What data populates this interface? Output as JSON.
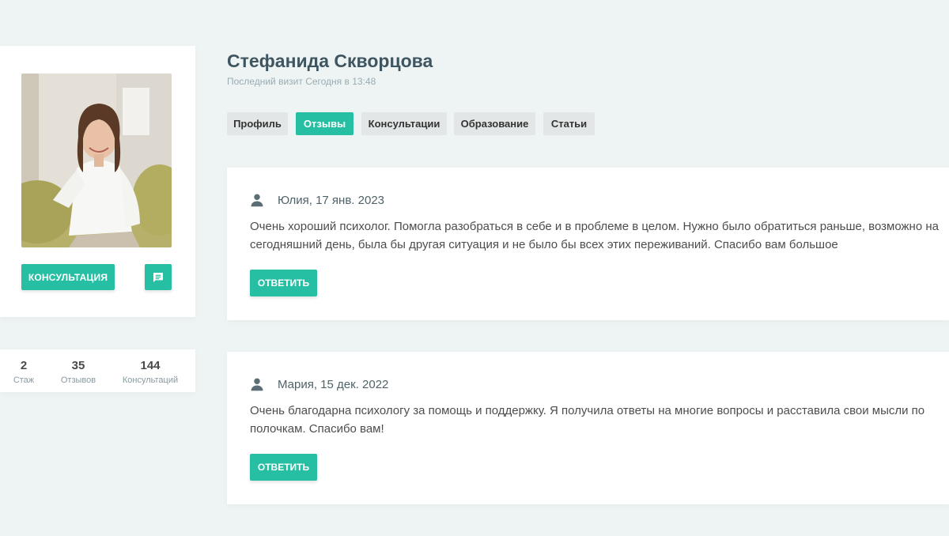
{
  "profile": {
    "name": "Стефанида Скворцова",
    "last_visit": "Последний визит Сегодня в 13:48",
    "consult_button": "КОНСУЛЬТАЦИЯ",
    "chat_icon": "chat-bubble-icon"
  },
  "stats": [
    {
      "value": "2",
      "label": "Стаж"
    },
    {
      "value": "35",
      "label": "Отзывов"
    },
    {
      "value": "144",
      "label": "Консультаций"
    }
  ],
  "tabs": [
    {
      "label": "Профиль",
      "active": false
    },
    {
      "label": "Отзывы",
      "active": true
    },
    {
      "label": "Консультации",
      "active": false
    },
    {
      "label": "Образование",
      "active": false
    },
    {
      "label": "Статьи",
      "active": false
    }
  ],
  "reviews": [
    {
      "author": "Юлия, 17 янв. 2023",
      "text": "Очень хороший психолог. Помогла разобраться в себе и в проблеме в целом. Нужно было обратиться раньше, возможно на сегодняшний день, была бы другая ситуация и не было бы всех этих переживаний. Спасибо вам большое",
      "reply_label": "ОТВЕТИТЬ"
    },
    {
      "author": "Мария, 15 дек. 2022",
      "text": "Очень благодарна психологу за помощь и поддержку. Я получила ответы на многие вопросы и расставила свои мысли по полочкам. Спасибо вам!",
      "reply_label": "ОТВЕТИТЬ"
    }
  ],
  "colors": {
    "accent": "#26bfa3",
    "background": "#eef4f4",
    "name_text": "#3f5560"
  }
}
